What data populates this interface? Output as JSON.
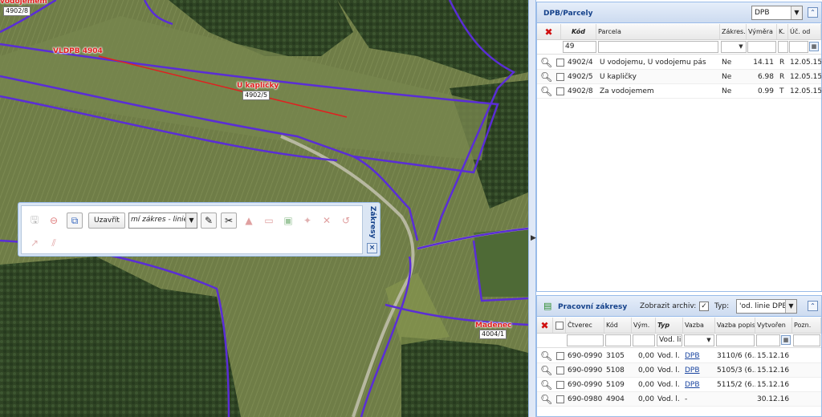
{
  "map": {
    "labels_red": [
      {
        "id": "vodojem-top",
        "text": "vodojemem"
      },
      {
        "id": "vldpb",
        "text": "VLDPB 4904"
      },
      {
        "id": "kaplicky",
        "text": "U kapličky"
      },
      {
        "id": "madenec",
        "text": "Madenec"
      }
    ],
    "labels_box": [
      {
        "id": "p49028",
        "text": "4902/8"
      },
      {
        "id": "p49025",
        "text": "4902/5"
      },
      {
        "id": "p40041",
        "text": "4004/1"
      }
    ]
  },
  "toolbar": {
    "close_label": "Uzavřít",
    "layer_select_value": "mí zákres - linie",
    "title": "Zákresy",
    "close_icon": "×"
  },
  "dpb_panel": {
    "title": "DPB/Parcely",
    "combo_value": "DPB",
    "columns": [
      "Kód",
      "Parcela",
      "Zákres.",
      "Výměra",
      "K.",
      "Úč. od"
    ],
    "filter_kod": "49",
    "rows": [
      {
        "kod": "4902/4",
        "parcela": "U vodojemu, U vodojemu pás",
        "zakres": "Ne",
        "vymera": "14.11",
        "k": "R",
        "uc_od": "12.05.15"
      },
      {
        "kod": "4902/5",
        "parcela": "U kapličky",
        "zakres": "Ne",
        "vymera": "6.98",
        "k": "R",
        "uc_od": "12.05.15"
      },
      {
        "kod": "4902/8",
        "parcela": "Za vodojemem",
        "zakres": "Ne",
        "vymera": "0.99",
        "k": "T",
        "uc_od": "12.05.15"
      }
    ]
  },
  "work_panel": {
    "title": "Pracovní zákresy",
    "archive_label": "Zobrazit archiv:",
    "type_label": "Typ:",
    "type_value": "'od. linie DPB",
    "columns": [
      "Čtverec",
      "Kód",
      "Vým.",
      "Typ",
      "Vazba",
      "Vazba popis",
      "Vytvořen",
      "Pozn."
    ],
    "filter_typ": "Vod. lin",
    "rows": [
      {
        "ctverec": "690-0990",
        "kod": "3105",
        "vym": "0,00",
        "typ": "Vod. l.",
        "vazba": "DPB",
        "vazba_popis": "3110/6 (6...",
        "vytvoren": "15.12.16"
      },
      {
        "ctverec": "690-0990",
        "kod": "5108",
        "vym": "0,00",
        "typ": "Vod. l.",
        "vazba": "DPB",
        "vazba_popis": "5105/3 (6...",
        "vytvoren": "15.12.16"
      },
      {
        "ctverec": "690-0990",
        "kod": "5109",
        "vym": "0,00",
        "typ": "Vod. l.",
        "vazba": "DPB",
        "vazba_popis": "5115/2 (6...",
        "vytvoren": "15.12.16"
      },
      {
        "ctverec": "690-0980",
        "kod": "4904",
        "vym": "0,00",
        "typ": "Vod. l.",
        "vazba": "-",
        "vazba_popis": "",
        "vytvoren": "30.12.16"
      }
    ]
  }
}
